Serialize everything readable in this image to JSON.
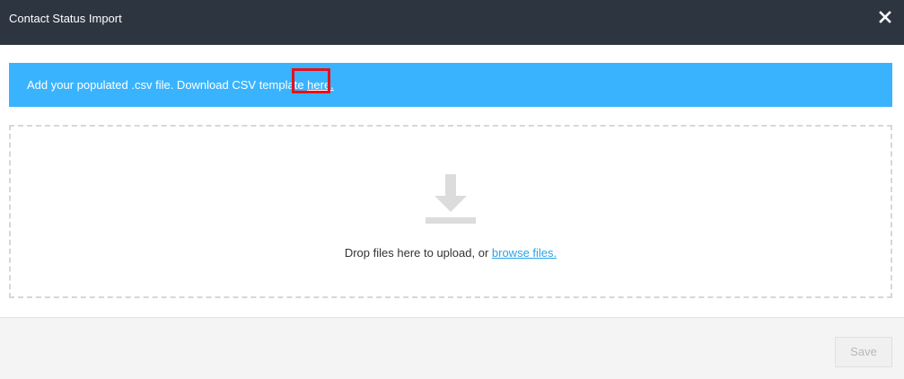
{
  "dialog": {
    "title": "Contact Status Import",
    "close_icon": "close-icon"
  },
  "info_bar": {
    "text": "Add your populated .csv file. Download CSV template ",
    "link_label": "here.",
    "background_color": "#3ab3ff",
    "highlight_color": "#e8101a"
  },
  "dropzone": {
    "icon": "download-arrow-icon",
    "text": "Drop files here to upload, or ",
    "link_label": "browse files.",
    "link_color": "#2aa3e8"
  },
  "footer": {
    "save_label": "Save",
    "save_disabled": true
  },
  "colors": {
    "header_background": "#2d3540",
    "footer_background": "#f4f4f4"
  }
}
